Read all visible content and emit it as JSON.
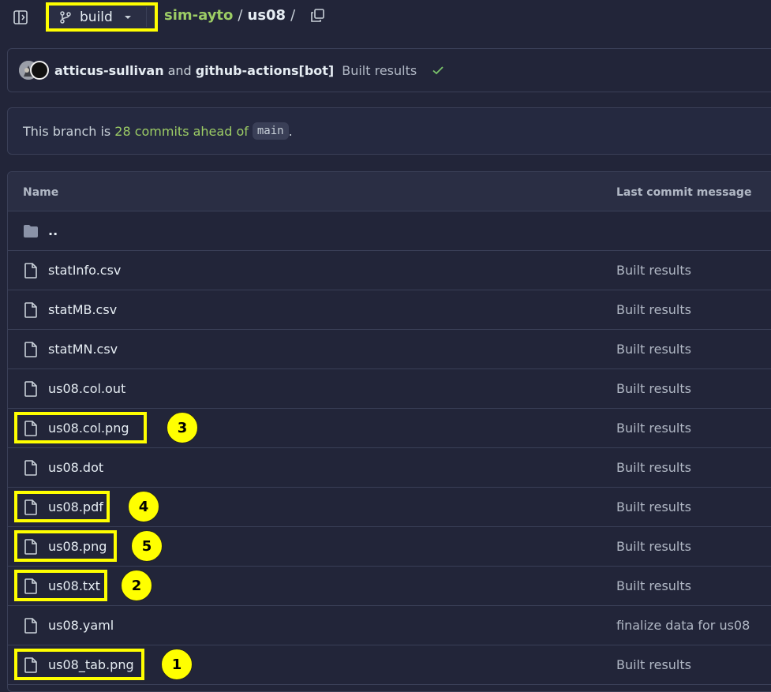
{
  "header": {
    "branch": "build",
    "repo": "sim-ayto",
    "sep1": "/",
    "dir": "us08",
    "sep2": "/"
  },
  "commit": {
    "author1": "atticus-sullivan",
    "and": "and",
    "author2": "github-actions[bot]",
    "message": "Built results"
  },
  "ahead": {
    "prefix": "This branch is",
    "link": "28 commits ahead of",
    "code": "main",
    "suffix": "."
  },
  "table": {
    "col_name": "Name",
    "col_msg": "Last commit message",
    "parent": "..",
    "files": [
      {
        "name": "statInfo.csv",
        "msg": "Built results"
      },
      {
        "name": "statMB.csv",
        "msg": "Built results"
      },
      {
        "name": "statMN.csv",
        "msg": "Built results"
      },
      {
        "name": "us08.col.out",
        "msg": "Built results"
      },
      {
        "name": "us08.col.png",
        "msg": "Built results",
        "badge": "3"
      },
      {
        "name": "us08.dot",
        "msg": "Built results"
      },
      {
        "name": "us08.pdf",
        "msg": "Built results",
        "badge": "4"
      },
      {
        "name": "us08.png",
        "msg": "Built results",
        "badge": "5"
      },
      {
        "name": "us08.txt",
        "msg": "Built results",
        "badge": "2"
      },
      {
        "name": "us08.yaml",
        "msg": "finalize data for us08"
      },
      {
        "name": "us08_tab.png",
        "msg": "Built results",
        "badge": "1"
      }
    ]
  },
  "colors": {
    "background": "#222539",
    "highlight": "#ffff00",
    "link_green": "#9ccc65"
  }
}
